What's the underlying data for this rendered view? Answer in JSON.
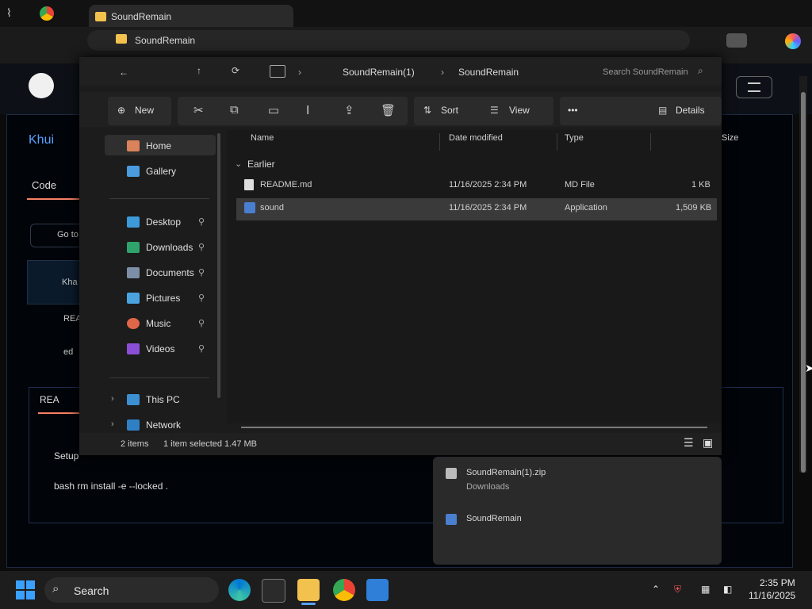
{
  "browser": {
    "tab_title": "SoundRemain",
    "address": "SoundRemain"
  },
  "github": {
    "repo": "Khui",
    "tabs": {
      "code": "Code",
      "readme": "REA"
    },
    "search_btn": "Go to",
    "left_items": [
      "Kha",
      "REA",
      "ed"
    ],
    "readme_lines": [
      "Setup",
      "bash rm install -e --locked ."
    ]
  },
  "explorer": {
    "path": [
      "SoundRemain(1)",
      "SoundRemain"
    ],
    "search_placeholder": "Search SoundRemain",
    "toolbar": {
      "new": "New",
      "sort": "Sort",
      "view": "View",
      "more": "•••",
      "details": "Details"
    },
    "nav": {
      "home": "Home",
      "gallery": "Gallery",
      "desktop": "Desktop",
      "downloads": "Downloads",
      "documents": "Documents",
      "pictures": "Pictures",
      "music": "Music",
      "videos": "Videos",
      "this_pc": "This PC",
      "network": "Network"
    },
    "columns": {
      "name": "Name",
      "date": "Date modified",
      "type": "Type",
      "size": "Size"
    },
    "group": "Earlier",
    "files": [
      {
        "name": "README.md",
        "date": "11/16/2025 2:34 PM",
        "type": "MD File",
        "size": "1 KB"
      },
      {
        "name": "sound",
        "date": "11/16/2025 2:34 PM",
        "type": "Application",
        "size": "1,509 KB"
      }
    ],
    "status": {
      "items": "2 items",
      "selected": "1 item selected  1.47 MB"
    }
  },
  "popup": {
    "line1": "SoundRemain(1).zip",
    "line2": "Downloads",
    "line3": "SoundRemain"
  },
  "taskbar": {
    "search": "Search",
    "time": "2:35 PM",
    "date": "11/16/2025"
  }
}
